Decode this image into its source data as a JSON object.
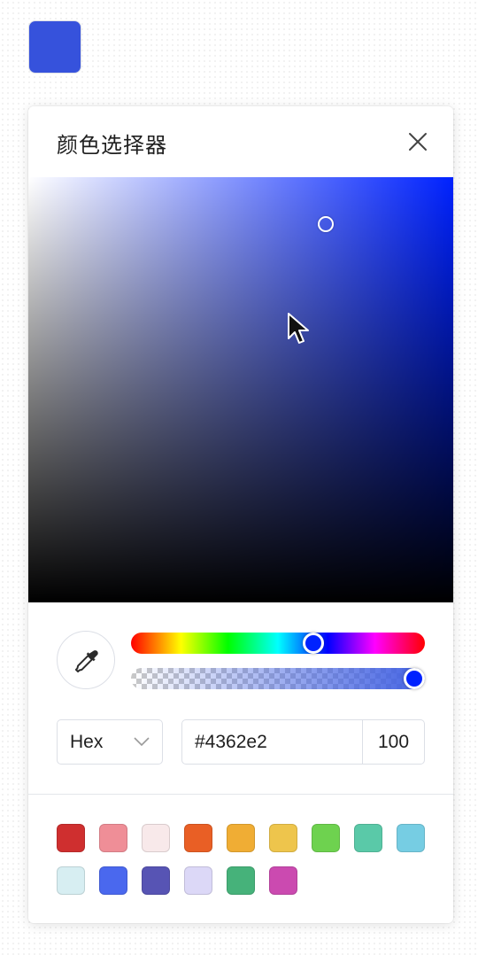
{
  "selected_color": "#3652dc",
  "dialog": {
    "title": "颜色选择器",
    "close_icon": "close-icon"
  },
  "picker": {
    "hue_color": "#0022ff",
    "hue_percent": 62,
    "alpha_percent": 100,
    "saturation": 0.7,
    "value": 0.89
  },
  "format": {
    "selected": "Hex",
    "dropdown_icon": "chevron-down-icon"
  },
  "hex_value": "#4362e2",
  "alpha_value": "100",
  "eyedropper_icon": "eyedropper-icon",
  "presets": [
    "#cf2f2f",
    "#ef8e97",
    "#f8e9ea",
    "#e95f25",
    "#f0ad34",
    "#eec54c",
    "#6ed24f",
    "#5ac9a8",
    "#76cde3",
    "#d7eef2",
    "#4a68ee",
    "#5754b4",
    "#dcd8f7",
    "#46b27a",
    "#cb4ab0"
  ]
}
